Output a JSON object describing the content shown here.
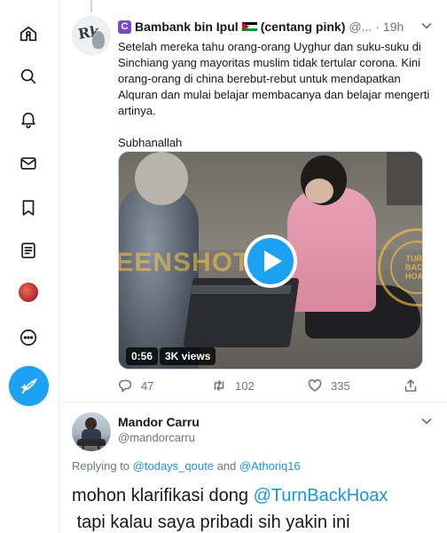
{
  "sidebar": {
    "items": [
      {
        "name": "home-icon"
      },
      {
        "name": "explore-icon"
      },
      {
        "name": "notifications-icon"
      },
      {
        "name": "messages-icon"
      },
      {
        "name": "bookmarks-icon"
      },
      {
        "name": "lists-icon"
      },
      {
        "name": "profile-avatar"
      },
      {
        "name": "more-icon"
      }
    ],
    "compose_icon": "compose-icon"
  },
  "tweet1": {
    "badge": "C",
    "name": "Bambank bin Ipul",
    "name_suffix": "(centang pink)",
    "handle": "@...",
    "dot": "·",
    "time": "19h",
    "paragraphs": [
      "Setelah mereka tahu orang-orang Uyghur dan suku-suku di Sinchiang yang mayoritas muslim tidak tertular corona. Kini orang-orang di china berebut-rebut untuk mendapatkan Alquran dan mulai belajar membacanya dan belajar mengerti artinya.",
      "Subhanallah"
    ],
    "video": {
      "duration": "0:56",
      "views": "3K views",
      "watermark_left": "SCREENSHOT",
      "watermark_right_1": "TURN",
      "watermark_right_2": "BACK",
      "watermark_right_3": "HOAX"
    },
    "actions": {
      "replies": "47",
      "retweets": "102",
      "likes": "335"
    }
  },
  "tweet2": {
    "name": "Mandor Carru",
    "handle": "@mandorcarru",
    "replying_prefix": "Replying to",
    "replying_to_1": "@todays_qoute",
    "replying_and": "and",
    "replying_to_2": "@Athoriq16",
    "text_part1": "mohon klarifikasi dong",
    "text_mention": "@TurnBackHoax",
    "text_line2": "tapi kalau saya pribadi sih yakin ini"
  },
  "colors": {
    "accent": "#1da1f2",
    "link": "#1b95e0",
    "secondary_text": "#657786",
    "verified_badge": "#794bc4"
  }
}
